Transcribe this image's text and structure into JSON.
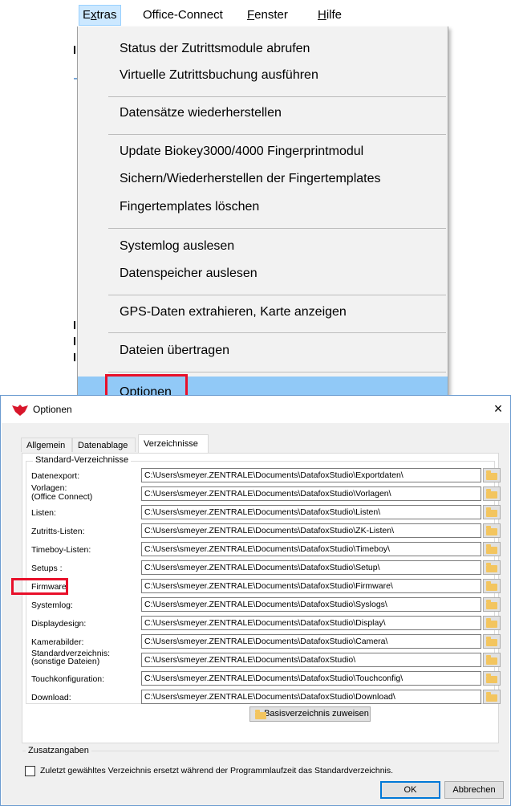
{
  "menubar": {
    "items": [
      "Extras",
      "Office-Connect",
      "Fenster",
      "Hilfe"
    ],
    "underlines": [
      "x",
      "",
      "F",
      "H"
    ]
  },
  "dropdown": {
    "items": [
      "Status der Zutrittsmodule abrufen",
      "Virtuelle Zutrittsbuchung ausführen",
      "Datensätze wiederherstellen",
      "Update Biokey3000/4000 Fingerprintmodul",
      "Sichern/Wiederherstellen der Fingertemplates",
      "Fingertemplates löschen",
      "Systemlog auslesen",
      "Datenspeicher auslesen",
      "GPS-Daten extrahieren, Karte anzeigen",
      "Dateien übertragen",
      "Optionen"
    ]
  },
  "dialog": {
    "title": "Optionen",
    "close_symbol": "×",
    "tabs": [
      "Allgemein",
      "Datenablage",
      "Verzeichnisse"
    ],
    "group_standard": "Standard-Verzeichnisse",
    "rows": [
      {
        "label": "Datenexport:",
        "path": "C:\\Users\\smeyer.ZENTRALE\\Documents\\DatafoxStudio\\Exportdaten\\"
      },
      {
        "label": "Vorlagen:\n(Office Connect)",
        "path": "C:\\Users\\smeyer.ZENTRALE\\Documents\\DatafoxStudio\\Vorlagen\\"
      },
      {
        "label": "Listen:",
        "path": "C:\\Users\\smeyer.ZENTRALE\\Documents\\DatafoxStudio\\Listen\\"
      },
      {
        "label": "Zutritts-Listen:",
        "path": "C:\\Users\\smeyer.ZENTRALE\\Documents\\DatafoxStudio\\ZK-Listen\\"
      },
      {
        "label": "Timeboy-Listen:",
        "path": "C:\\Users\\smeyer.ZENTRALE\\Documents\\DatafoxStudio\\Timeboy\\"
      },
      {
        "label": "Setups :",
        "path": "C:\\Users\\smeyer.ZENTRALE\\Documents\\DatafoxStudio\\Setup\\"
      },
      {
        "label": "Firmware:",
        "path": "C:\\Users\\smeyer.ZENTRALE\\Documents\\DatafoxStudio\\Firmware\\"
      },
      {
        "label": "Systemlog:",
        "path": "C:\\Users\\smeyer.ZENTRALE\\Documents\\DatafoxStudio\\Syslogs\\"
      },
      {
        "label": "Displaydesign:",
        "path": "C:\\Users\\smeyer.ZENTRALE\\Documents\\DatafoxStudio\\Display\\"
      },
      {
        "label": "Kamerabilder:",
        "path": "C:\\Users\\smeyer.ZENTRALE\\Documents\\DatafoxStudio\\Camera\\"
      },
      {
        "label": "Standardverzeichnis:\n(sonstige Dateien)",
        "path": "C:\\Users\\smeyer.ZENTRALE\\Documents\\DatafoxStudio\\"
      },
      {
        "label": "Touchkonfiguration:",
        "path": "C:\\Users\\smeyer.ZENTRALE\\Documents\\DatafoxStudio\\Touchconfig\\"
      },
      {
        "label": "Download:",
        "path": "C:\\Users\\smeyer.ZENTRALE\\Documents\\DatafoxStudio\\Download\\"
      }
    ],
    "base_button": "Basisverzeichnis zuweisen",
    "group_extra": "Zusatzangaben",
    "checkbox_label": "Zuletzt gewähltes Verzeichnis ersetzt während der Programmlaufzeit das Standardverzeichnis.",
    "ok_button": "OK",
    "cancel_button": "Abbrechen"
  },
  "colors": {
    "highlight": "#91c9f7",
    "annotation_red": "#e8102a",
    "folder": "#f3c55f"
  }
}
